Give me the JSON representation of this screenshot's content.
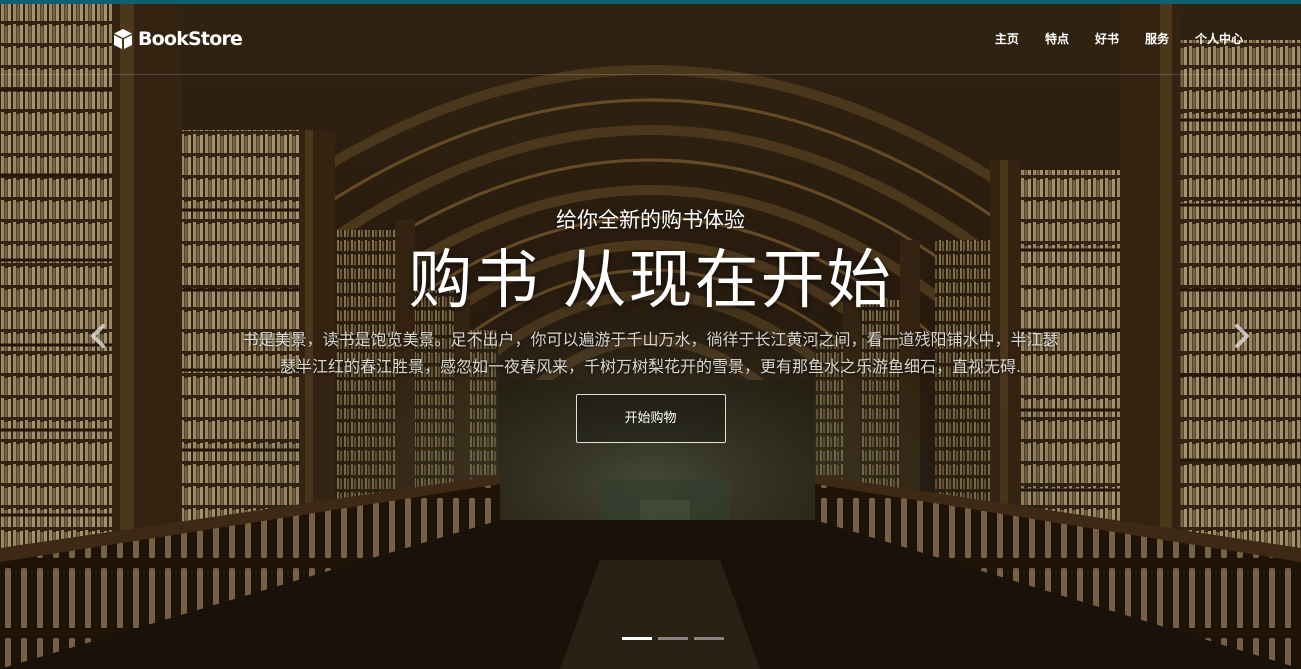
{
  "brand": {
    "name": "BookStore",
    "icon": "cube-icon"
  },
  "nav": {
    "items": [
      {
        "label": "主页"
      },
      {
        "label": "特点"
      },
      {
        "label": "好书"
      },
      {
        "label": "服务"
      },
      {
        "label": "个人中心"
      }
    ]
  },
  "hero": {
    "subtitle": "给你全新的购书体验",
    "title": "购书 从现在开始",
    "description": "书是美景，读书是饱览美景。足不出户，你可以遍游于千山万水，徜徉于长江黄河之间，看一道残阳铺水中，半江瑟瑟半江红的春江胜景，感忽如一夜春风来，千树万树梨花开的雪景，更有那鱼水之乐游鱼细石，直视无碍.",
    "cta_label": "开始购物"
  },
  "carousel": {
    "prev_icon": "chevron-left-icon",
    "next_icon": "chevron-right-icon",
    "slide_count": 3,
    "active_index": 0
  },
  "colors": {
    "top_accent": "#0d5f73",
    "text": "#ffffff",
    "description_text": "#d9d6d0"
  }
}
